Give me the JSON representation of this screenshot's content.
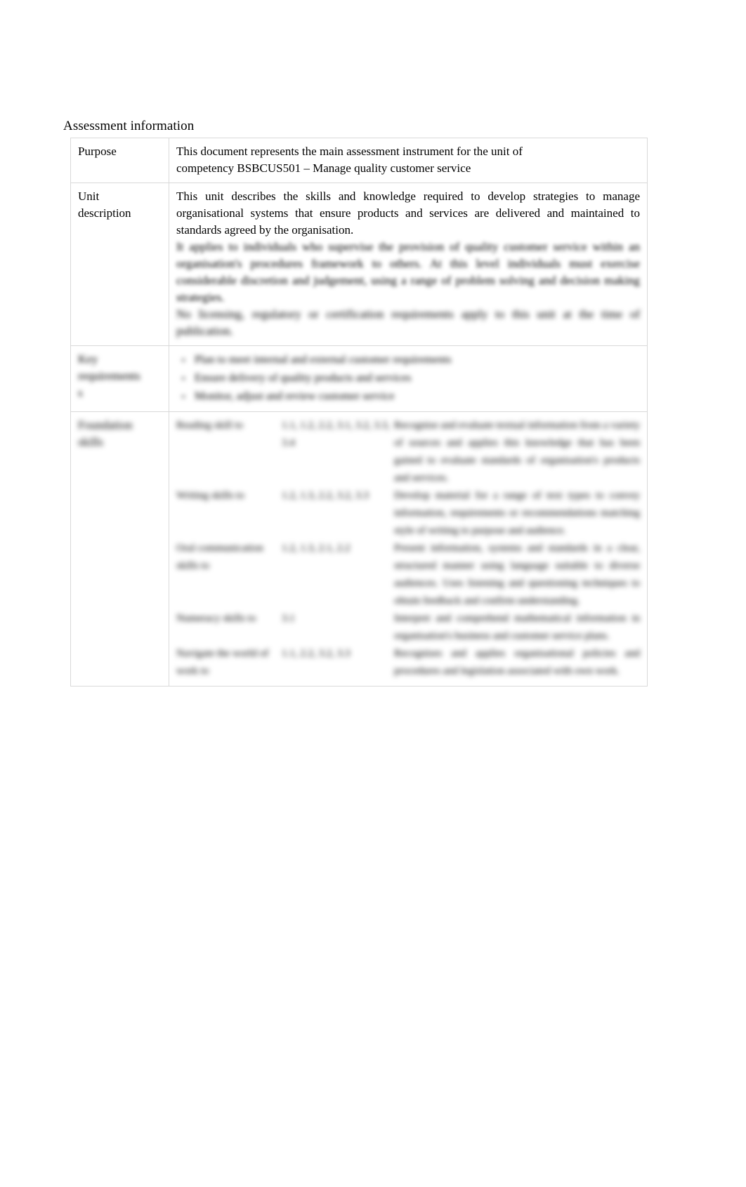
{
  "document": {
    "title": "Assessment information"
  },
  "table": {
    "rows": [
      {
        "label": "Purpose",
        "lines": [
          "This document represents the main assessment instrument for the unit of",
          "competency       BSBCUS501 – Manage quality customer service"
        ]
      },
      {
        "label": "Unit description",
        "label_line1": "Unit",
        "label_line2": "description",
        "paragraph": "This unit describes the skills and knowledge required to develop strategies to manage organisational systems that ensure products and services are delivered and maintained to standards agreed by the organisation.",
        "paragraph_blurred_1": "It applies to individuals who supervise the provision of quality customer service within an organisation's procedures framework to others. At this level individuals must exercise considerable discretion and judgement, using a range of problem solving and decision making strategies.",
        "paragraph_blurred_2": "No licensing, regulatory or certification requirements apply to this unit at the time of publication."
      },
      {
        "label_line1": "Key",
        "label_line2": "requirements",
        "label_line3": "s",
        "bullets": [
          "Plan to meet internal and external customer requirements",
          "Ensure delivery of quality products and services",
          "Monitor, adjust and review customer service"
        ]
      },
      {
        "label_line1": "Foundation",
        "label_line2": "skills",
        "skills": [
          {
            "skill": "Reading skill to",
            "codes": "1.1, 1.2, 2.2,  3.1, 3.2, 3.3, 3.4",
            "description": "Recognise and evaluate textual information from a variety of sources and applies this knowledge that has been gained to evaluate standards of organisation's products and services."
          },
          {
            "skill": "Writing skills to",
            "codes": "1.2, 1.3, 2.2, 3.2, 3.3",
            "description": "Develop material for a range of text types to convey information, requirements or recommendations matching style of writing to purpose and audience."
          },
          {
            "skill": "Oral communication skills to",
            "codes": "1.2, 1.3, 2.1, 2.2",
            "description": "Present information, systems and standards in a clear, structured manner using language suitable to diverse audiences. Uses listening and questioning techniques to obtain feedback and confirm understanding."
          },
          {
            "skill": "Numeracy skills to",
            "codes": "3.1",
            "description": "Interpret and comprehend mathematical information in organisation's business and customer service plans."
          },
          {
            "skill": "Navigate the world of work to",
            "codes": "1.1, 2.2, 3.2, 3.3",
            "description": "Recognises and applies organisational policies and procedures and legislation associated with own work."
          }
        ]
      }
    ]
  }
}
